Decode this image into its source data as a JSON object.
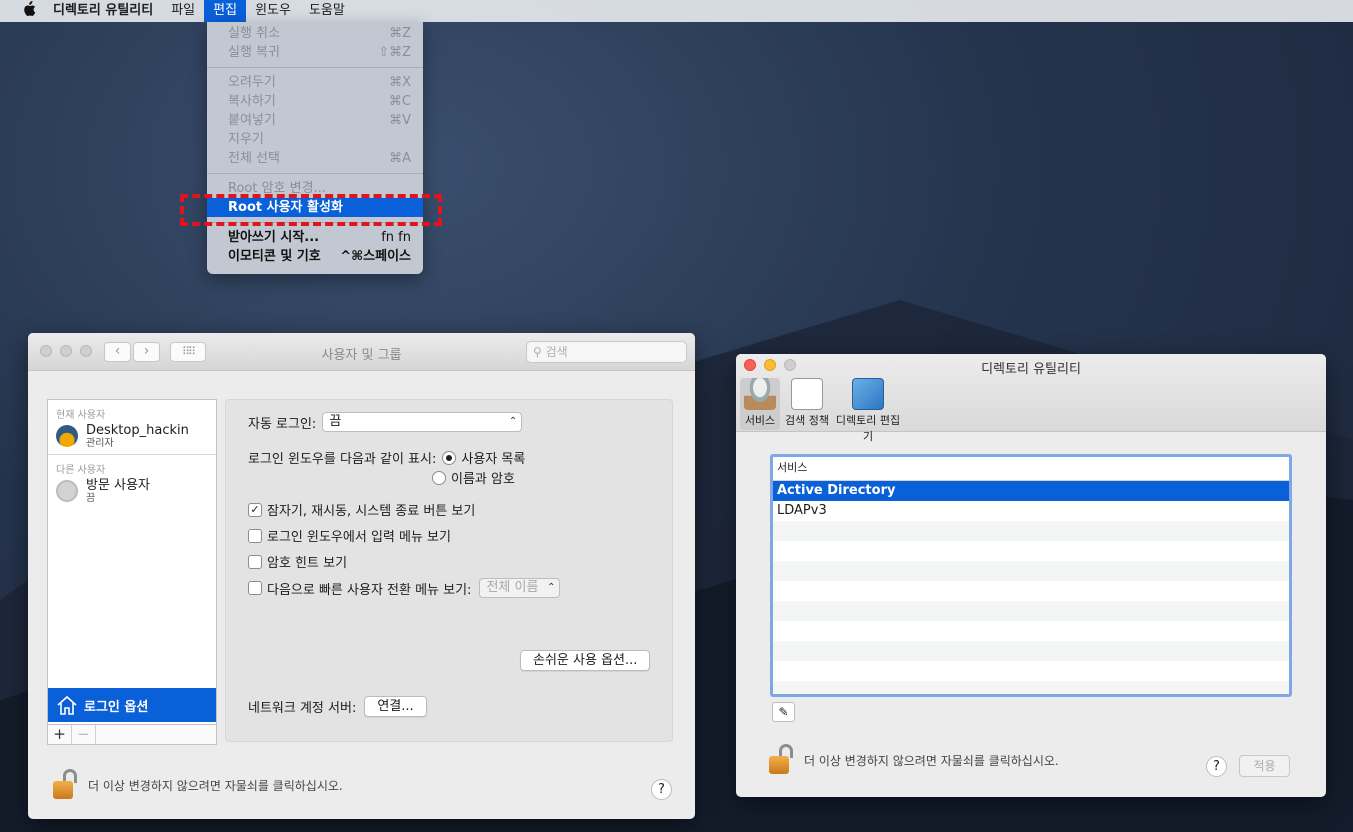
{
  "menubar": {
    "apple": "",
    "app_name": "디렉토리 유틸리티",
    "items": [
      "파일",
      "편집",
      "윈도우",
      "도움말"
    ]
  },
  "edit_menu": {
    "undo": {
      "label": "실행 취소",
      "shortcut": "⌘Z"
    },
    "redo": {
      "label": "실행 복귀",
      "shortcut": "⇧⌘Z"
    },
    "cut": {
      "label": "오려두기",
      "shortcut": "⌘X"
    },
    "copy": {
      "label": "복사하기",
      "shortcut": "⌘C"
    },
    "paste": {
      "label": "붙여넣기",
      "shortcut": "⌘V"
    },
    "delete": {
      "label": "지우기",
      "shortcut": ""
    },
    "select_all": {
      "label": "전체 선택",
      "shortcut": "⌘A"
    },
    "change_root_pw": {
      "label": "Root 암호 변경...",
      "shortcut": ""
    },
    "enable_root": {
      "label": "Root 사용자 활성화",
      "shortcut": ""
    },
    "dictation": {
      "label": "받아쓰기 시작...",
      "shortcut": "fn fn"
    },
    "emoji": {
      "label": "이모티콘 및 기호",
      "shortcut": "^⌘스페이스"
    }
  },
  "users_window": {
    "title": "사용자 및 그룹",
    "search_placeholder": "검색",
    "current_users_label": "현재 사용자",
    "current_user": {
      "name": "Desktop_hackin",
      "role": "관리자"
    },
    "other_users_label": "다른 사용자",
    "guest_user": {
      "name": "방문 사용자",
      "status": "끔"
    },
    "login_options_label": "로그인 옵션",
    "auto_login_label": "자동 로그인:",
    "auto_login_value": "끔",
    "display_login_label": "로그인 윈도우를 다음과 같이 표시:",
    "radio_user_list": "사용자 목록",
    "radio_name_password": "이름과 암호",
    "cb_sleep_restart": "잠자기, 재시동, 시스템 종료 버튼 보기",
    "cb_input_menu": "로그인 윈도우에서 입력 메뉴 보기",
    "cb_password_hint": "암호 힌트 보기",
    "cb_fast_switch": "다음으로 빠른 사용자 전환 메뉴 보기:",
    "fast_switch_value": "전체 이름",
    "accessibility_button": "손쉬운 사용 옵션...",
    "network_server_label": "네트워크 계정 서버:",
    "connect_button": "연결...",
    "lock_text": "더 이상 변경하지 않으려면 자물쇠를 클릭하십시오.",
    "help": "?"
  },
  "directory_window": {
    "title": "디렉토리 유틸리티",
    "toolbar": [
      "서비스",
      "검색 정책",
      "디렉토리 편집기"
    ],
    "table_header": "서비스",
    "services": [
      "Active Directory",
      "LDAPv3"
    ],
    "lock_text": "더 이상 변경하지 않으려면 자물쇠를 클릭하십시오.",
    "help": "?",
    "apply_button": "적용"
  }
}
